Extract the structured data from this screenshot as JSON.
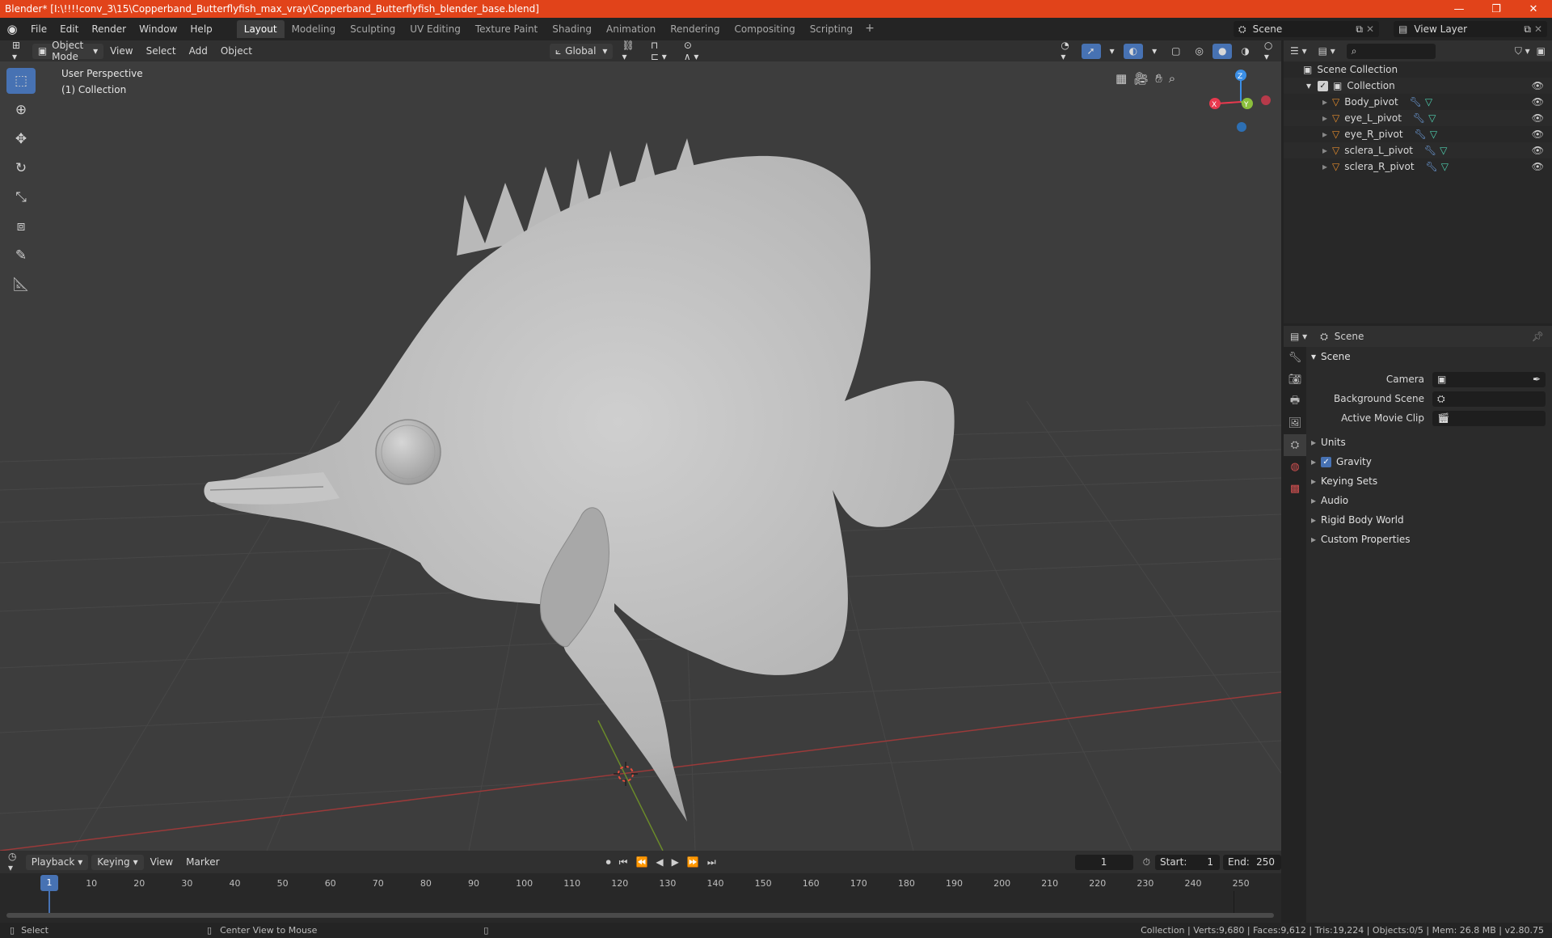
{
  "window": {
    "title": "Blender* [I:\\!!!!conv_3\\15\\Copperband_Butterflyfish_max_vray\\Copperband_Butterflyfish_blender_base.blend]",
    "minimize": "—",
    "maximize": "❐",
    "close": "✕"
  },
  "menu": [
    "File",
    "Edit",
    "Render",
    "Window",
    "Help"
  ],
  "workspaces": [
    {
      "label": "Layout",
      "active": true
    },
    {
      "label": "Modeling"
    },
    {
      "label": "Sculpting"
    },
    {
      "label": "UV Editing"
    },
    {
      "label": "Texture Paint"
    },
    {
      "label": "Shading"
    },
    {
      "label": "Animation"
    },
    {
      "label": "Rendering"
    },
    {
      "label": "Compositing"
    },
    {
      "label": "Scripting"
    }
  ],
  "workspace_add": "+",
  "scene_selector": {
    "value": "Scene"
  },
  "view_layer_selector": {
    "value": "View Layer"
  },
  "viewport_header": {
    "mode": "Object Mode",
    "menus": [
      "View",
      "Select",
      "Add",
      "Object"
    ],
    "transform_orientation": "Global"
  },
  "viewport": {
    "perspective_label": "User Perspective",
    "collection_label": "(1) Collection",
    "gizmo_axes": {
      "x": "X",
      "y": "Y",
      "z": "Z"
    }
  },
  "outliner": {
    "search_placeholder": "",
    "scene_collection": "Scene Collection",
    "collection": "Collection",
    "objects": [
      "Body_pivot",
      "eye_L_pivot",
      "eye_R_pivot",
      "sclera_L_pivot",
      "sclera_R_pivot"
    ]
  },
  "properties": {
    "context": "Scene",
    "panel_title": "Scene",
    "fields": [
      {
        "label": "Camera",
        "value": ""
      },
      {
        "label": "Background Scene",
        "value": ""
      },
      {
        "label": "Active Movie Clip",
        "value": ""
      }
    ],
    "subpanels": [
      "Units",
      "Gravity",
      "Keying Sets",
      "Audio",
      "Rigid Body World",
      "Custom Properties"
    ],
    "gravity_enabled": true
  },
  "timeline": {
    "menus": [
      "Playback",
      "Keying",
      "View",
      "Marker"
    ],
    "current_frame": "1",
    "start_label": "Start:",
    "start_value": "1",
    "end_label": "End:",
    "end_value": "250",
    "ticks": [
      "1",
      "10",
      "20",
      "30",
      "40",
      "50",
      "60",
      "70",
      "80",
      "90",
      "100",
      "110",
      "120",
      "130",
      "140",
      "150",
      "160",
      "170",
      "180",
      "190",
      "200",
      "210",
      "220",
      "230",
      "240",
      "250"
    ]
  },
  "statusbar": {
    "left_action": "Select",
    "middle_action": "Center View to Mouse",
    "stats": "Collection | Verts:9,680 | Faces:9,612 | Tris:19,224 | Objects:0/5 | Mem: 26.8 MB | v2.80.75"
  },
  "colors": {
    "title_bar": "#e1431a",
    "accent": "#4772b3",
    "axis_x": "#e8394e",
    "axis_y": "#8bbf3c",
    "axis_z": "#3b8fe6",
    "object_icon": "#e38b2c"
  }
}
